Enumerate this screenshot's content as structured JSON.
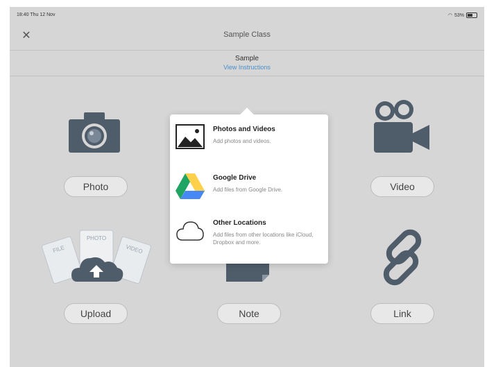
{
  "status_bar": {
    "time_date": "18:40 Thu 12 Nov",
    "battery": "53%"
  },
  "navbar": {
    "close_icon": "✕",
    "title": "Sample Class"
  },
  "subheader": {
    "title": "Sample",
    "link": "View Instructions"
  },
  "tiles": {
    "photo": "Photo",
    "video": "Video",
    "upload": "Upload",
    "note": "Note",
    "link": "Link"
  },
  "upload_card_labels": {
    "left": "FILE",
    "center": "PHOTO",
    "right": "VIDEO"
  },
  "popup": {
    "options": [
      {
        "icon": "image-icon",
        "title": "Photos and Videos",
        "description": "Add photos and videos."
      },
      {
        "icon": "google-drive-icon",
        "title": "Google Drive",
        "description": "Add files from Google Drive."
      },
      {
        "icon": "cloud-icon",
        "title": "Other Locations",
        "description": "Add files from other locations like iCloud, Dropbox and more."
      }
    ]
  },
  "colors": {
    "icon": "#4f5c6a",
    "link": "#4a8ec9",
    "background": "#d6d6d6",
    "drive_green": "#1fa463",
    "drive_yellow": "#ffd04b",
    "drive_blue": "#4688f4"
  }
}
